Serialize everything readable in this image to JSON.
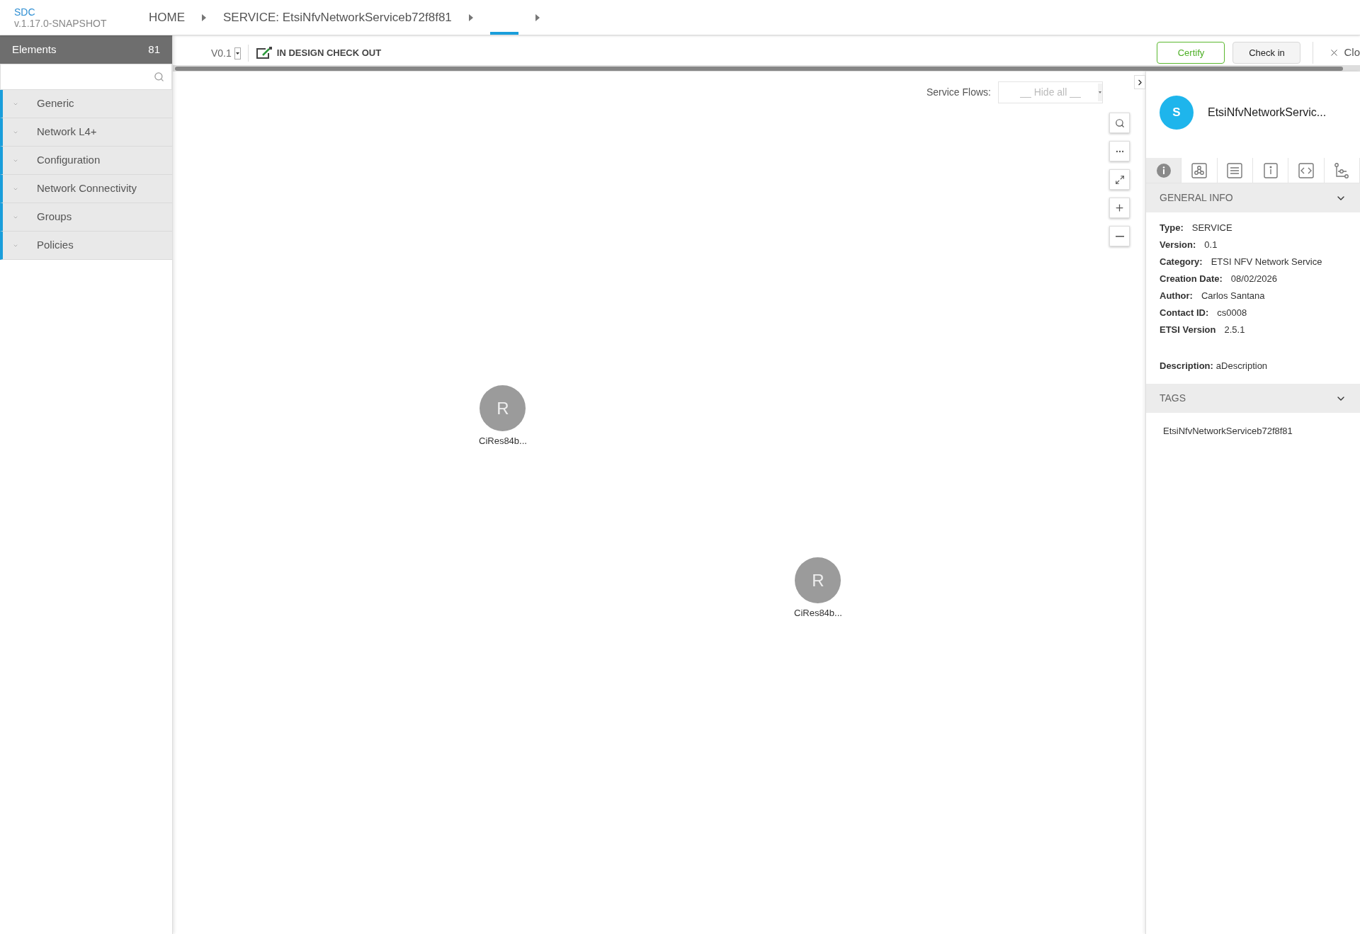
{
  "app": {
    "name": "SDC",
    "version": "v.1.17.0-SNAPSHOT"
  },
  "breadcrumbs": [
    {
      "label": "HOME",
      "selected": false
    },
    {
      "label": "SERVICE: EtsiNfvNetworkServiceb72f8f81",
      "selected": false
    },
    {
      "selected": true
    }
  ],
  "sidebar": {
    "title": "Elements",
    "count": "81",
    "items": [
      {
        "label": "Generic",
        "expanded": false
      },
      {
        "label": "Network L4+",
        "expanded": false
      },
      {
        "label": "Configuration",
        "expanded": false
      },
      {
        "label": "Network Connectivity",
        "expanded": false
      },
      {
        "label": "Groups",
        "expanded": false
      },
      {
        "label": "Policies",
        "expanded": false
      }
    ]
  },
  "toolbar": {
    "version": "V0.1",
    "status": "IN DESIGN CHECK OUT",
    "buttons": [
      {
        "label": "Certify",
        "kind": "primary"
      },
      {
        "label": "Check in",
        "kind": "default"
      },
      {
        "label": "Clo",
        "kind": "close"
      }
    ]
  },
  "canvas": {
    "service_flows_label": "Service Flows:",
    "service_flows_value": "__ Hide all __",
    "nodes": [
      {
        "initial": "R",
        "label": "CiRes84b..."
      },
      {
        "initial": "R",
        "label": "CiRes84b..."
      }
    ]
  },
  "details": {
    "avatar": "S",
    "title": "EtsiNfvNetworkServic...",
    "tabs": [
      {
        "kind": "info",
        "selected": true
      },
      {
        "kind": "composition",
        "selected": false
      },
      {
        "kind": "document",
        "selected": false
      },
      {
        "kind": "properties",
        "selected": false
      },
      {
        "kind": "code",
        "selected": false
      },
      {
        "kind": "flow",
        "selected": false
      }
    ],
    "general_info": {
      "title": "GENERAL INFO",
      "expanded": true,
      "fields": [
        {
          "label": "Type:",
          "value": "SERVICE"
        },
        {
          "label": "Version:",
          "value": "0.1"
        },
        {
          "label": "Category:",
          "value": "ETSI NFV Network Service"
        },
        {
          "label": "Creation Date:",
          "value": "08/02/2026"
        },
        {
          "label": "Author:",
          "value": "Carlos Santana"
        },
        {
          "label": "Contact ID:",
          "value": "cs0008"
        },
        {
          "label": "ETSI Version",
          "value": "2.5.1"
        }
      ],
      "description_label": "Description:",
      "description": "aDescription"
    },
    "tags": {
      "title": "TAGS",
      "expanded": true,
      "items": [
        "EtsiNfvNetworkServiceb72f8f81"
      ]
    }
  }
}
